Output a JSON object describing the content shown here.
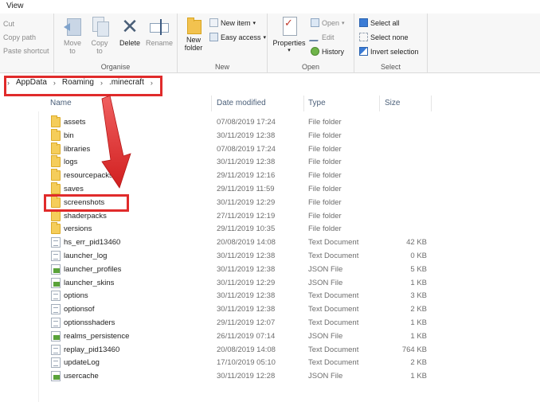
{
  "tabs": {
    "view": "View"
  },
  "clipboard": {
    "cut": "Cut",
    "copy_path": "Copy path",
    "paste_shortcut": "Paste shortcut"
  },
  "organise": {
    "move_to": "Move to",
    "copy_to": "Copy to",
    "delete": "Delete",
    "rename": "Rename",
    "label": "Organise"
  },
  "new": {
    "new_folder": "New folder",
    "new_item": "New item",
    "easy_access": "Easy access",
    "label": "New"
  },
  "open": {
    "properties": "Properties",
    "open": "Open",
    "edit": "Edit",
    "history": "History",
    "label": "Open"
  },
  "select": {
    "select_all": "Select all",
    "select_none": "Select none",
    "invert_selection": "Invert selection",
    "label": "Select"
  },
  "address": {
    "crumbs": [
      "AppData",
      "Roaming",
      ".minecraft"
    ]
  },
  "columns": {
    "name": "Name",
    "date": "Date modified",
    "type": "Type",
    "size": "Size"
  },
  "files": [
    {
      "name": "assets",
      "date": "07/08/2019 17:24",
      "type": "File folder",
      "size": "",
      "icon": "folder"
    },
    {
      "name": "bin",
      "date": "30/11/2019 12:38",
      "type": "File folder",
      "size": "",
      "icon": "folder"
    },
    {
      "name": "libraries",
      "date": "07/08/2019 17:24",
      "type": "File folder",
      "size": "",
      "icon": "folder"
    },
    {
      "name": "logs",
      "date": "30/11/2019 12:38",
      "type": "File folder",
      "size": "",
      "icon": "folder"
    },
    {
      "name": "resourcepacks",
      "date": "29/11/2019 12:16",
      "type": "File folder",
      "size": "",
      "icon": "folder"
    },
    {
      "name": "saves",
      "date": "29/11/2019 11:59",
      "type": "File folder",
      "size": "",
      "icon": "folder"
    },
    {
      "name": "screenshots",
      "date": "30/11/2019 12:29",
      "type": "File folder",
      "size": "",
      "icon": "folder"
    },
    {
      "name": "shaderpacks",
      "date": "27/11/2019 12:19",
      "type": "File folder",
      "size": "",
      "icon": "folder"
    },
    {
      "name": "versions",
      "date": "29/11/2019 10:35",
      "type": "File folder",
      "size": "",
      "icon": "folder"
    },
    {
      "name": "hs_err_pid13460",
      "date": "20/08/2019 14:08",
      "type": "Text Document",
      "size": "42 KB",
      "icon": "text"
    },
    {
      "name": "launcher_log",
      "date": "30/11/2019 12:38",
      "type": "Text Document",
      "size": "0 KB",
      "icon": "text"
    },
    {
      "name": "launcher_profiles",
      "date": "30/11/2019 12:38",
      "type": "JSON File",
      "size": "5 KB",
      "icon": "json"
    },
    {
      "name": "launcher_skins",
      "date": "30/11/2019 12:29",
      "type": "JSON File",
      "size": "1 KB",
      "icon": "json"
    },
    {
      "name": "options",
      "date": "30/11/2019 12:38",
      "type": "Text Document",
      "size": "3 KB",
      "icon": "text"
    },
    {
      "name": "optionsof",
      "date": "30/11/2019 12:38",
      "type": "Text Document",
      "size": "2 KB",
      "icon": "text"
    },
    {
      "name": "optionsshaders",
      "date": "29/11/2019 12:07",
      "type": "Text Document",
      "size": "1 KB",
      "icon": "text"
    },
    {
      "name": "realms_persistence",
      "date": "26/11/2019 07:14",
      "type": "JSON File",
      "size": "1 KB",
      "icon": "json"
    },
    {
      "name": "replay_pid13460",
      "date": "20/08/2019 14:08",
      "type": "Text Document",
      "size": "764 KB",
      "icon": "text"
    },
    {
      "name": "updateLog",
      "date": "17/10/2019 05:10",
      "type": "Text Document",
      "size": "2 KB",
      "icon": "text"
    },
    {
      "name": "usercache",
      "date": "30/11/2019 12:28",
      "type": "JSON File",
      "size": "1 KB",
      "icon": "json"
    }
  ],
  "highlight_color": "#e02b2b"
}
